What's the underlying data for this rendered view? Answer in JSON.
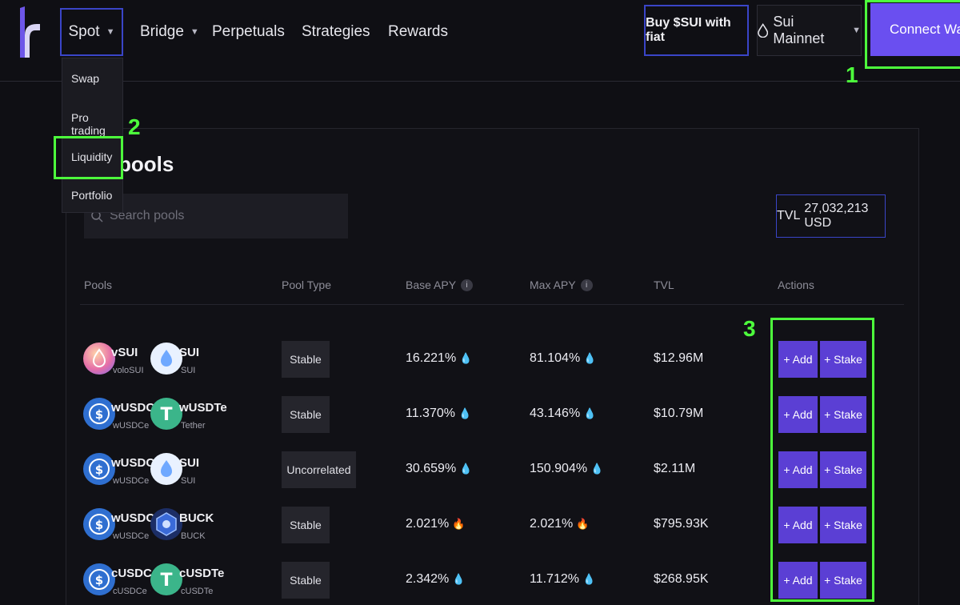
{
  "nav": {
    "spot": "Spot",
    "bridge": "Bridge",
    "perpetuals": "Perpetuals",
    "strategies": "Strategies",
    "rewards": "Rewards",
    "buy": "Buy $SUI with fiat",
    "network": "Sui Mainnet",
    "connect": "Connect Wallet"
  },
  "dropdown": {
    "items": [
      "Swap",
      "Pro trading",
      "Liquidity",
      "Portfolio"
    ]
  },
  "page": {
    "title_tail": "pools",
    "search_placeholder": "Search pools",
    "tvl_label": "TVL",
    "tvl_value": "27,032,213 USD"
  },
  "table": {
    "headers": [
      "Pools",
      "Pool Type",
      "Base APY",
      "Max APY",
      "TVL",
      "Actions"
    ],
    "rows": [
      {
        "t1": "vSUI",
        "t1s": "voloSUI",
        "t2": "SUI",
        "t2s": "SUI",
        "type": "Stable",
        "base": "16.221%",
        "max": "81.104%",
        "base_icon": "droplet",
        "max_icon": "droplet",
        "tvl": "$12.96M",
        "add": "+ Add",
        "stake": "+ Stake"
      },
      {
        "t1": "wUSDCe",
        "t1s": "wUSDCe",
        "t2": "wUSDTe",
        "t2s": "Tether",
        "type": "Stable",
        "base": "11.370%",
        "max": "43.146%",
        "base_icon": "droplet",
        "max_icon": "droplet",
        "tvl": "$10.79M",
        "add": "+ Add",
        "stake": "+ Stake"
      },
      {
        "t1": "wUSDCe",
        "t1s": "wUSDCe",
        "t2": "SUI",
        "t2s": "SUI",
        "type": "Uncorrelated",
        "base": "30.659%",
        "max": "150.904%",
        "base_icon": "droplet",
        "max_icon": "droplet",
        "tvl": "$2.11M",
        "add": "+ Add",
        "stake": "+ Stake"
      },
      {
        "t1": "wUSDCe",
        "t1s": "wUSDCe",
        "t2": "BUCK",
        "t2s": "BUCK",
        "type": "Stable",
        "base": "2.021%",
        "max": "2.021%",
        "base_icon": "fire",
        "max_icon": "fire",
        "tvl": "$795.93K",
        "add": "+ Add",
        "stake": "+ Stake"
      },
      {
        "t1": "cUSDCe",
        "t1s": "cUSDCe",
        "t2": "cUSDTe",
        "t2s": "cUSDTe",
        "type": "Stable",
        "base": "2.342%",
        "max": "11.712%",
        "base_icon": "droplet",
        "max_icon": "droplet",
        "tvl": "$268.95K",
        "add": "+ Add",
        "stake": "+ Stake"
      }
    ]
  },
  "annotations": {
    "n1": "1",
    "n2": "2",
    "n3": "3"
  },
  "colors": {
    "accent": "#6a4ff0",
    "highlight": "#4dff3c",
    "outline": "#3a45c8"
  }
}
